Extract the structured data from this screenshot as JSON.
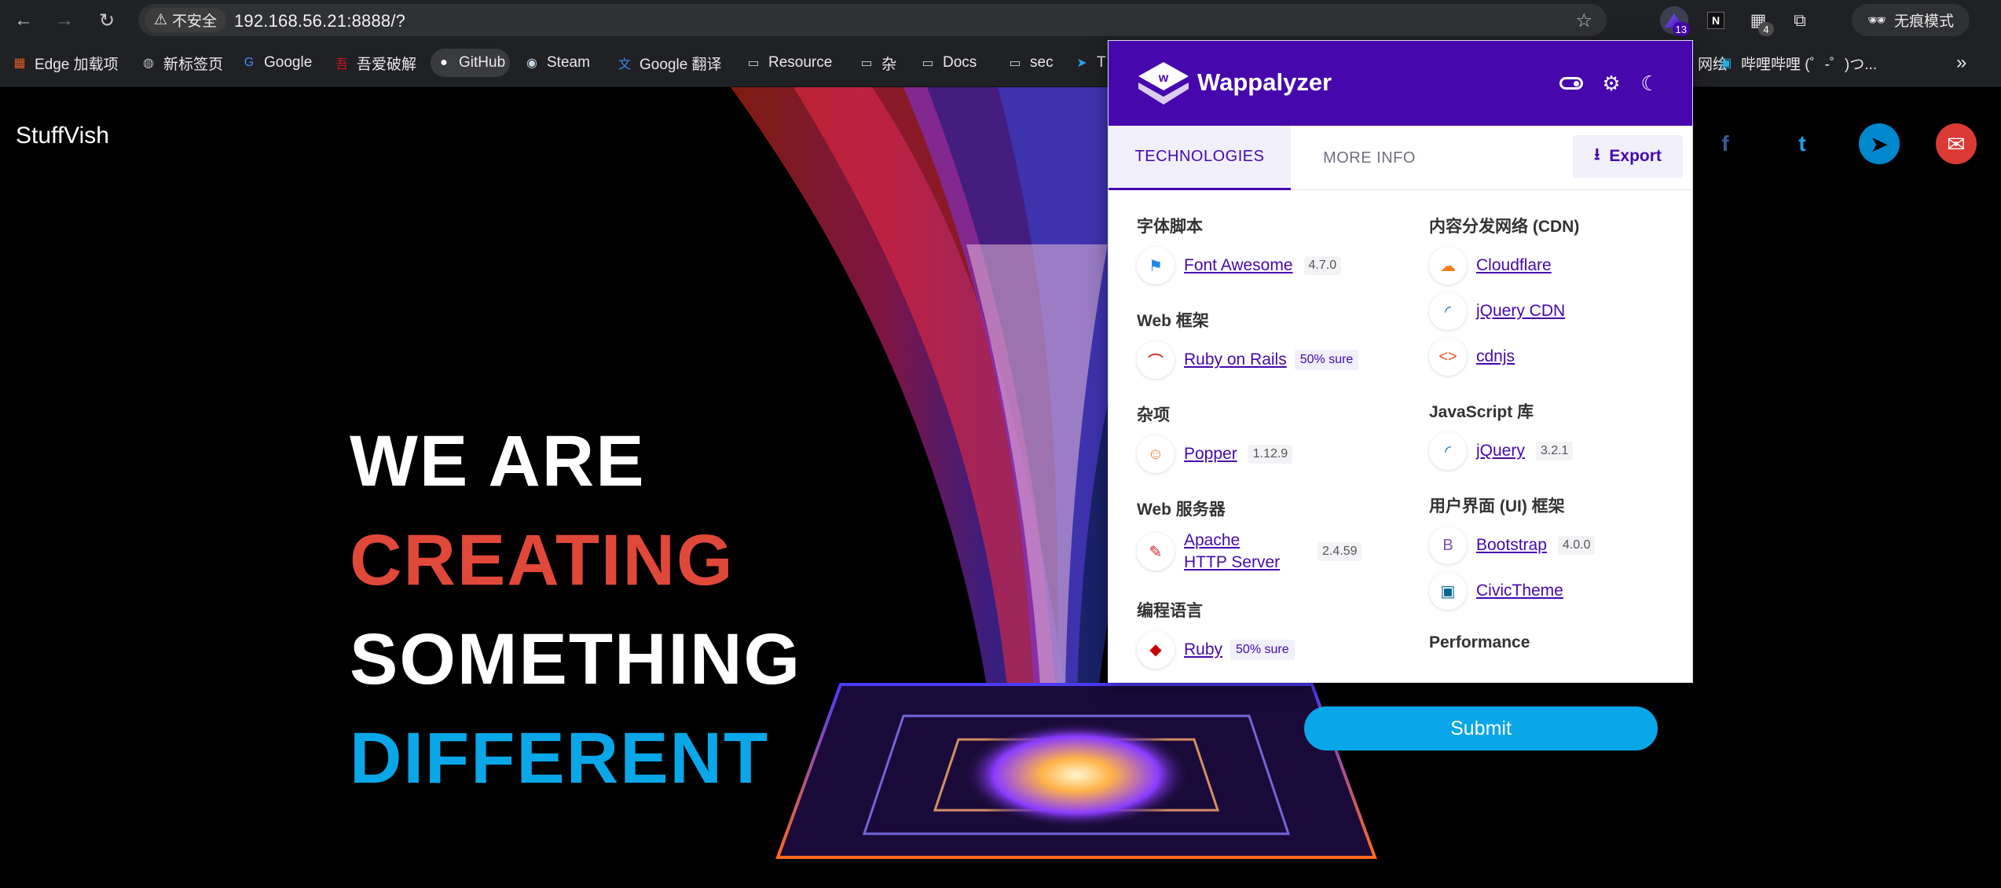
{
  "browser": {
    "back_icon": "←",
    "forward_icon": "→",
    "reload_icon": "↻",
    "security_label": "不安全",
    "url": "192.168.56.21:8888/?",
    "star_icon": "☆",
    "ext_badges": [
      "13",
      "4"
    ],
    "incognito_label": "无痕模式",
    "overflow_icon": "»"
  },
  "bookmarks": [
    {
      "label": "Edge 加载项",
      "icon": "▦",
      "color": "#e25c27"
    },
    {
      "label": "新标签页",
      "icon": "◍",
      "color": "#bbbbbb"
    },
    {
      "label": "Google",
      "icon": "G",
      "color": "#4285f4"
    },
    {
      "label": "吾爱破解",
      "icon": "吾",
      "color": "#c7171e"
    },
    {
      "label": "GitHub",
      "icon": "●",
      "color": "#ffffff"
    },
    {
      "label": "Steam",
      "icon": "◉",
      "color": "#c6d4df"
    },
    {
      "label": "Google 翻译",
      "icon": "文",
      "color": "#4285f4"
    },
    {
      "label": "Resource",
      "icon": "▭",
      "color": "#cfcfcf"
    },
    {
      "label": "杂",
      "icon": "▭",
      "color": "#cfcfcf"
    },
    {
      "label": "Docs",
      "icon": "▭",
      "color": "#cfcfcf"
    },
    {
      "label": "sec",
      "icon": "▭",
      "color": "#cfcfcf"
    },
    {
      "label": "T",
      "icon": "➤",
      "color": "#2aa3e0"
    },
    {
      "label": "哔哩哔哩 (゜-゜)つ...",
      "icon": "▣",
      "color": "#23ade5"
    }
  ],
  "bookmarks_partial": "网绘",
  "site": {
    "brand": "StuffVish",
    "hero_lines": [
      "WE ARE",
      "CREATING",
      "SOMETHING",
      "DIFFERENT"
    ],
    "hero_colors": [
      "#ffffff",
      "#e0483a",
      "#ffffff",
      "#0aa7e8"
    ],
    "social": [
      {
        "label": "f",
        "icon": "facebook-icon",
        "bg": "transparent",
        "fg": "#3b5998"
      },
      {
        "label": "t",
        "icon": "twitter-icon",
        "bg": "transparent",
        "fg": "#1da1f2"
      },
      {
        "label": "➤",
        "icon": "telegram-icon",
        "bg": "#0088cc",
        "fg": "#000000"
      },
      {
        "label": "✉",
        "icon": "email-icon",
        "bg": "#db3a34",
        "fg": "#ffffff"
      }
    ],
    "submit_label": "Submit"
  },
  "wappalyzer": {
    "title": "Wappalyzer",
    "tabs": [
      "TECHNOLOGIES",
      "MORE INFO"
    ],
    "export_label": "Export",
    "export_icon": "⭳",
    "toggle_icon": "⏽",
    "settings_icon": "⚙",
    "theme_icon": "☾",
    "left_column": [
      {
        "category": "字体脚本",
        "items": [
          {
            "name": "Font Awesome",
            "version": "4.7.0",
            "confidence": "",
            "icon": "⚑",
            "icon_color": "#1c88ed"
          }
        ]
      },
      {
        "category": "Web 框架",
        "items": [
          {
            "name": "Ruby on Rails",
            "version": "",
            "confidence": "50% sure",
            "icon": "⌒",
            "icon_color": "#cc0000"
          }
        ]
      },
      {
        "category": "杂项",
        "items": [
          {
            "name": "Popper",
            "version": "1.12.9",
            "confidence": "",
            "icon": "☺",
            "icon_color": "#e08530"
          }
        ]
      },
      {
        "category": "Web 服务器",
        "items": [
          {
            "name": "Apache HTTP Server",
            "version": "2.4.59",
            "confidence": "",
            "icon": "✎",
            "icon_color": "#d22128"
          }
        ]
      },
      {
        "category": "编程语言",
        "items": [
          {
            "name": "Ruby",
            "version": "",
            "confidence": "50% sure",
            "icon": "◆",
            "icon_color": "#cc0000"
          }
        ]
      }
    ],
    "right_column": [
      {
        "category": "内容分发网络 (CDN)",
        "items": [
          {
            "name": "Cloudflare",
            "version": "",
            "confidence": "",
            "icon": "☁",
            "icon_color": "#f38020"
          },
          {
            "name": "jQuery CDN",
            "version": "",
            "confidence": "",
            "icon": "◜",
            "icon_color": "#0769ad"
          },
          {
            "name": "cdnjs",
            "version": "",
            "confidence": "",
            "icon": "<>",
            "icon_color": "#e95420"
          }
        ]
      },
      {
        "category": "JavaScript 库",
        "items": [
          {
            "name": "jQuery",
            "version": "3.2.1",
            "confidence": "",
            "icon": "◜",
            "icon_color": "#0769ad"
          }
        ]
      },
      {
        "category": "用户界面 (UI) 框架",
        "items": [
          {
            "name": "Bootstrap",
            "version": "4.0.0",
            "confidence": "",
            "icon": "B",
            "icon_color": "#7952b3"
          },
          {
            "name": "CivicTheme",
            "version": "",
            "confidence": "",
            "icon": "▣",
            "icon_color": "#00698f"
          }
        ]
      },
      {
        "category": "Performance",
        "items": []
      }
    ]
  }
}
